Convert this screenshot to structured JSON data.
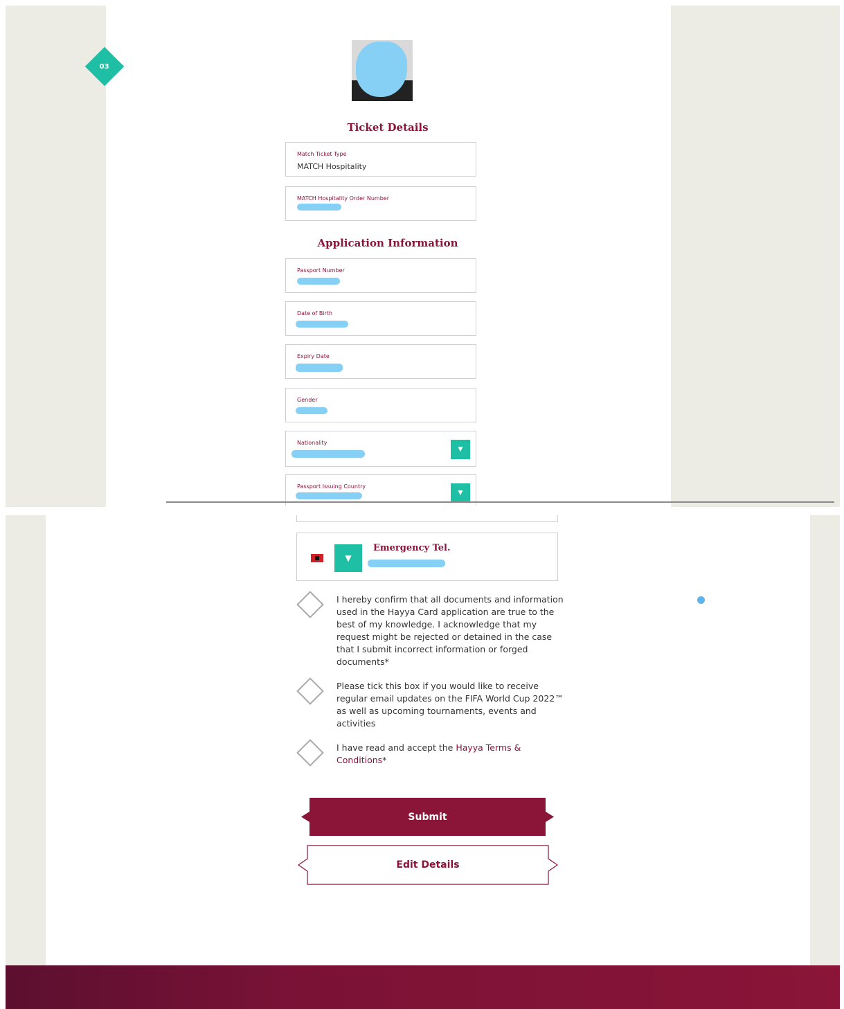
{
  "step_badge": "03",
  "ticket_section": {
    "title": "Ticket Details",
    "fields": [
      {
        "label": "Match Ticket Type",
        "value": "MATCH Hospitality"
      },
      {
        "label": "MATCH Hospitality Order Number",
        "value": ""
      }
    ]
  },
  "application_section": {
    "title": "Application Information",
    "fields": [
      {
        "label": "Passport Number"
      },
      {
        "label": "Date of Birth"
      },
      {
        "label": "Expiry Date"
      },
      {
        "label": "Gender"
      },
      {
        "label": "Nationality"
      },
      {
        "label": "Passport Issuing Country"
      }
    ]
  },
  "emergency": {
    "label": "Emergency Tel."
  },
  "checkboxes": [
    {
      "text": "I hereby confirm that all documents and information used in the Hayya Card application are true to the best of my knowledge. I acknowledge that my request might be rejected or detained in the case that I submit incorrect information or forged documents*"
    },
    {
      "text": "Please tick this box if you would like to receive regular email updates on the FIFA World Cup 2022™ as well as upcoming tournaments, events and activities"
    },
    {
      "text_before": "I have read and accept the ",
      "link": "Hayya Terms & Conditions",
      "text_after": "*"
    }
  ],
  "buttons": {
    "submit": "Submit",
    "edit": "Edit Details"
  },
  "colors": {
    "maroon": "#8a1538",
    "teal": "#1fbfa6",
    "background": "#ecebe4",
    "redaction": "#86cff5"
  }
}
